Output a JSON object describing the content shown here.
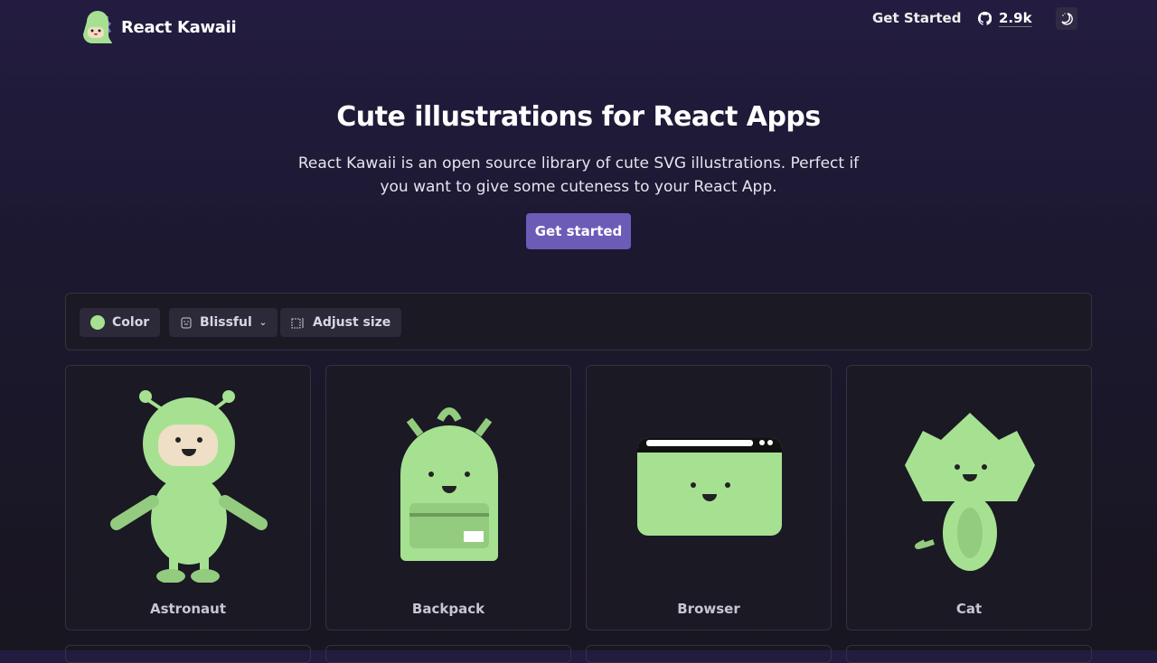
{
  "nav": {
    "brand": "React Kawaii",
    "get_started": "Get Started",
    "github_stars": "2.9k"
  },
  "hero": {
    "title": "Cute illustrations for React Apps",
    "subtitle": "React Kawaii is an open source library of cute SVG illustrations. Perfect if you want to give some cuteness to your React App.",
    "cta": "Get started"
  },
  "toolbar": {
    "color_label": "Color",
    "color": "#a6e191",
    "mood": "Blissful",
    "size_label": "Adjust size"
  },
  "cards": [
    {
      "label": "Astronaut"
    },
    {
      "label": "Backpack"
    },
    {
      "label": "Browser"
    },
    {
      "label": "Cat"
    }
  ]
}
